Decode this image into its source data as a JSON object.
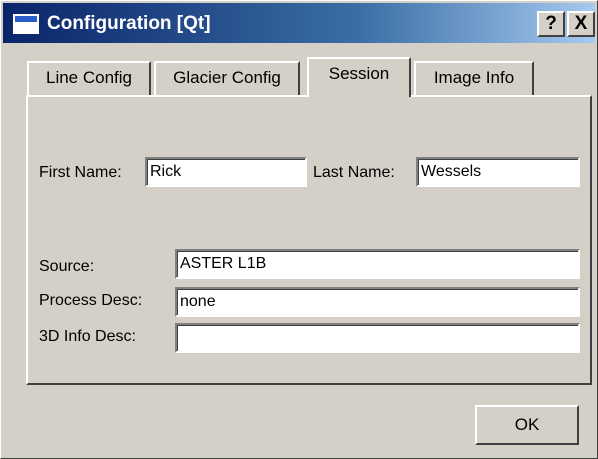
{
  "window": {
    "title": "Configuration [Qt]",
    "help_label": "?",
    "close_label": "X"
  },
  "tabs": [
    {
      "label": "Line Config",
      "active": false
    },
    {
      "label": "Glacier Config",
      "active": false
    },
    {
      "label": "Session",
      "active": true
    },
    {
      "label": "Image Info",
      "active": false
    }
  ],
  "session": {
    "first_name_label": "First Name:",
    "first_name_value": "Rick",
    "last_name_label": "Last Name:",
    "last_name_value": "Wessels",
    "source_label": "Source:",
    "source_value": "ASTER L1B",
    "process_desc_label": "Process Desc:",
    "process_desc_value": "none",
    "info3d_desc_label": "3D Info Desc:",
    "info3d_desc_value": ""
  },
  "footer": {
    "ok_label": "OK"
  },
  "colors": {
    "dialog_face": "#d4d0c8",
    "titlebar_start": "#0a246a",
    "titlebar_end": "#a6caf0"
  }
}
